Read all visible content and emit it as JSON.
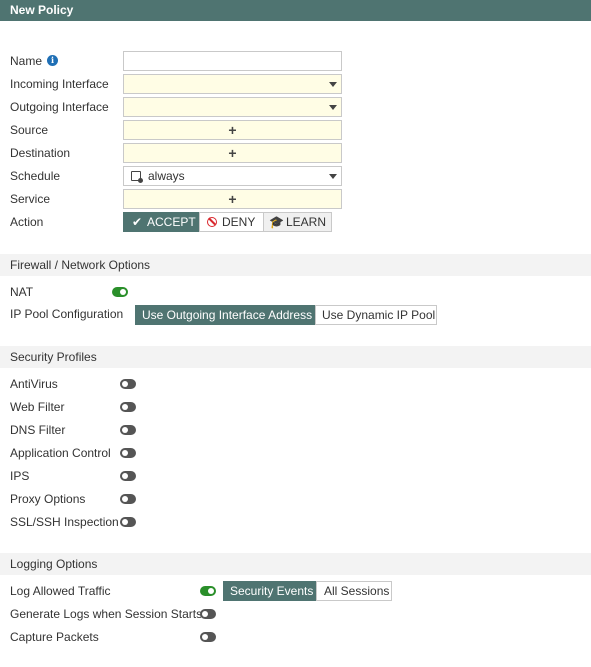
{
  "window": {
    "title": "New Policy"
  },
  "form": {
    "name_label": "Name",
    "name_value": "",
    "incoming_label": "Incoming Interface",
    "outgoing_label": "Outgoing Interface",
    "source_label": "Source",
    "destination_label": "Destination",
    "schedule_label": "Schedule",
    "schedule_value": "always",
    "service_label": "Service",
    "action_label": "Action",
    "add_symbol": "+",
    "action_options": [
      {
        "label": "ACCEPT",
        "selected": true,
        "icon": "check-icon"
      },
      {
        "label": "DENY",
        "selected": false,
        "icon": "deny-icon"
      },
      {
        "label": "LEARN",
        "selected": false,
        "icon": "learn-icon"
      }
    ]
  },
  "firewall_section": {
    "title": "Firewall / Network Options",
    "nat_label": "NAT",
    "nat_enabled": true,
    "ip_pool_label": "IP Pool Configuration",
    "ip_pool_options": [
      {
        "label": "Use Outgoing Interface Address",
        "selected": true
      },
      {
        "label": "Use Dynamic IP Pool",
        "selected": false
      }
    ]
  },
  "security_section": {
    "title": "Security Profiles",
    "profiles": [
      {
        "label": "AntiVirus",
        "enabled": false
      },
      {
        "label": "Web Filter",
        "enabled": false
      },
      {
        "label": "DNS Filter",
        "enabled": false
      },
      {
        "label": "Application Control",
        "enabled": false
      },
      {
        "label": "IPS",
        "enabled": false
      },
      {
        "label": "Proxy Options",
        "enabled": false
      },
      {
        "label": "SSL/SSH Inspection",
        "enabled": false
      }
    ]
  },
  "logging_section": {
    "title": "Logging Options",
    "log_allowed_label": "Log Allowed Traffic",
    "log_allowed_enabled": true,
    "log_options": [
      {
        "label": "Security Events",
        "selected": true
      },
      {
        "label": "All Sessions",
        "selected": false
      }
    ],
    "session_start_label": "Generate Logs when Session Starts",
    "session_start_enabled": false,
    "capture_label": "Capture Packets",
    "capture_enabled": false
  },
  "colors": {
    "accent": "#4f7471",
    "field_highlight": "#fffde5",
    "toggle_on": "#2a8f2a",
    "toggle_off": "#555555",
    "deny_red": "#d9262c",
    "info_blue": "#1f6fb5"
  }
}
